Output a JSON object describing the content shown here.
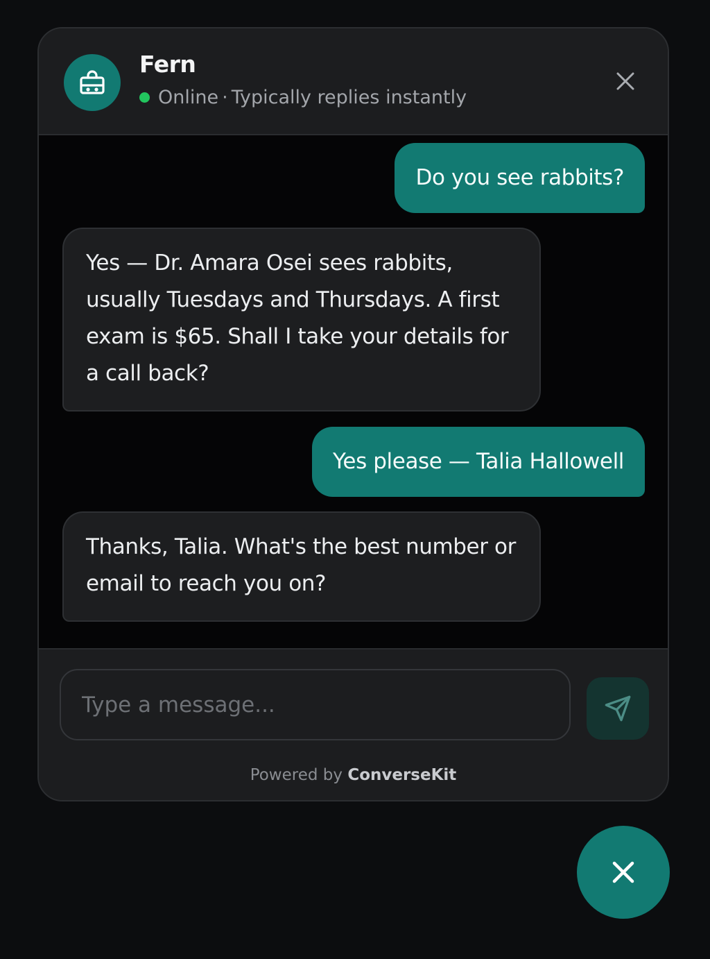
{
  "header": {
    "bot_name": "Fern",
    "status": "Online",
    "separator": "·",
    "reply_note": "Typically replies instantly",
    "avatar_icon": "robot-icon",
    "close_icon": "close-icon"
  },
  "messages": [
    {
      "sender": "user",
      "text": "Do you see rabbits?"
    },
    {
      "sender": "bot",
      "text": "Yes — Dr. Amara Osei sees rabbits, usually Tuesdays and Thursdays. A first exam is $65. Shall I take your details for a call back?"
    },
    {
      "sender": "user",
      "text": "Yes please — Talia Hallowell"
    },
    {
      "sender": "bot",
      "text": "Thanks, Talia. What's the best number or email to reach you on?"
    }
  ],
  "composer": {
    "placeholder": "Type a message...",
    "value": "",
    "send_icon": "send-icon"
  },
  "footer": {
    "powered_prefix": "Powered by",
    "brand": "ConverseKit"
  },
  "launcher": {
    "icon": "close-icon"
  },
  "colors": {
    "accent": "#127a72",
    "online": "#22c55e",
    "panel": "#1c1d1f",
    "background": "#0c0d0f"
  }
}
